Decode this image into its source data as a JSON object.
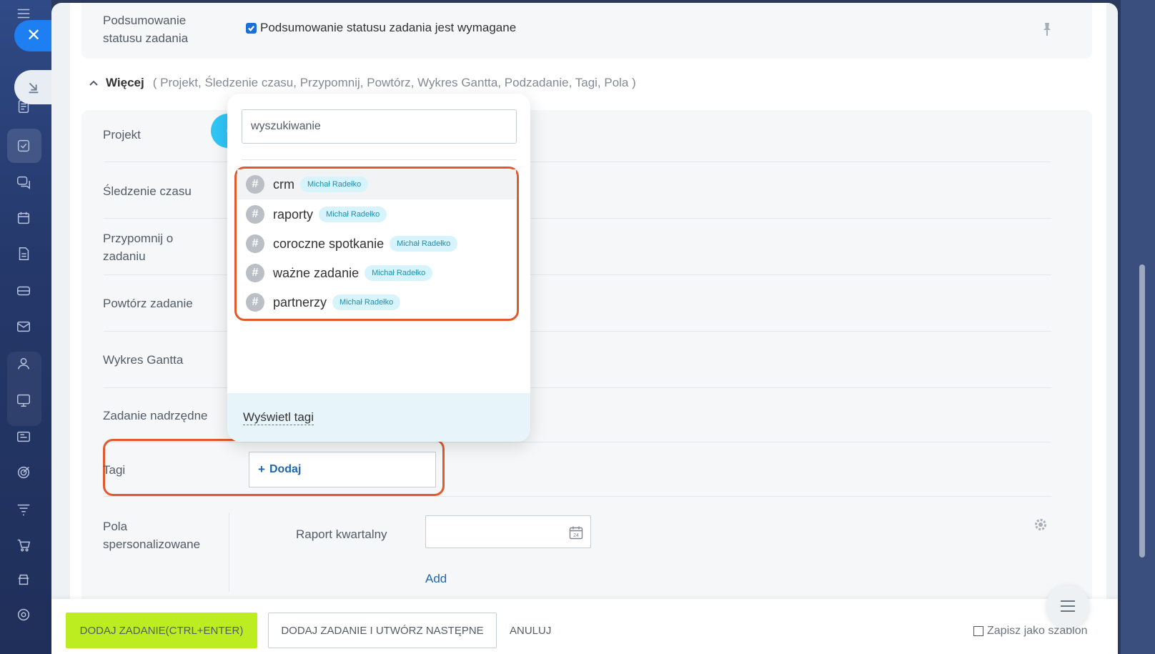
{
  "status_summary": {
    "label": "Podsumowanie statusu zadania",
    "checkbox_label": "Podsumowanie statusu zadania jest wymagane",
    "checked": true
  },
  "more": {
    "title": "Więcej",
    "list": "( Projekt,  Śledzenie czasu,  Przypomnij,  Powtórz,  Wykres Gantta,  Podzadanie,  Tagi,  Pola )"
  },
  "fields": {
    "project": "Projekt",
    "time_tracking": "Śledzenie czasu",
    "remind": "Przypomnij o zadaniu",
    "repeat": "Powtórz zadanie",
    "gantt": "Wykres Gantta",
    "parent_task": "Zadanie nadrzędne",
    "tags": "Tagi",
    "custom_fields": "Pola spersonalizowane"
  },
  "tags_field": {
    "add_label": "Dodaj"
  },
  "custom": {
    "field_label": "Raport kwartalny",
    "add_link": "Add"
  },
  "dropdown": {
    "search_placeholder": "wyszukiwanie",
    "items": [
      {
        "name": "crm",
        "owner": "Michał Radełko"
      },
      {
        "name": "raporty",
        "owner": "Michał Radełko"
      },
      {
        "name": "coroczne spotkanie",
        "owner": "Michał Radełko"
      },
      {
        "name": "ważne zadanie",
        "owner": "Michał Radełko"
      },
      {
        "name": "partnerzy",
        "owner": "Michał Radełko"
      }
    ],
    "footer_link": "Wyświetl tagi"
  },
  "footer": {
    "add_task": "DODAJ ZADANIE(CTRL+ENTER)",
    "add_and_next": "DODAJ ZADANIE I UTWÓRZ NASTĘPNE",
    "cancel": "ANULUJ",
    "save_template": "Zapisz jako szablon"
  },
  "colors": {
    "accent": "#1d6fd8",
    "highlight": "#e05a2d",
    "primary_button": "#bbed21"
  }
}
